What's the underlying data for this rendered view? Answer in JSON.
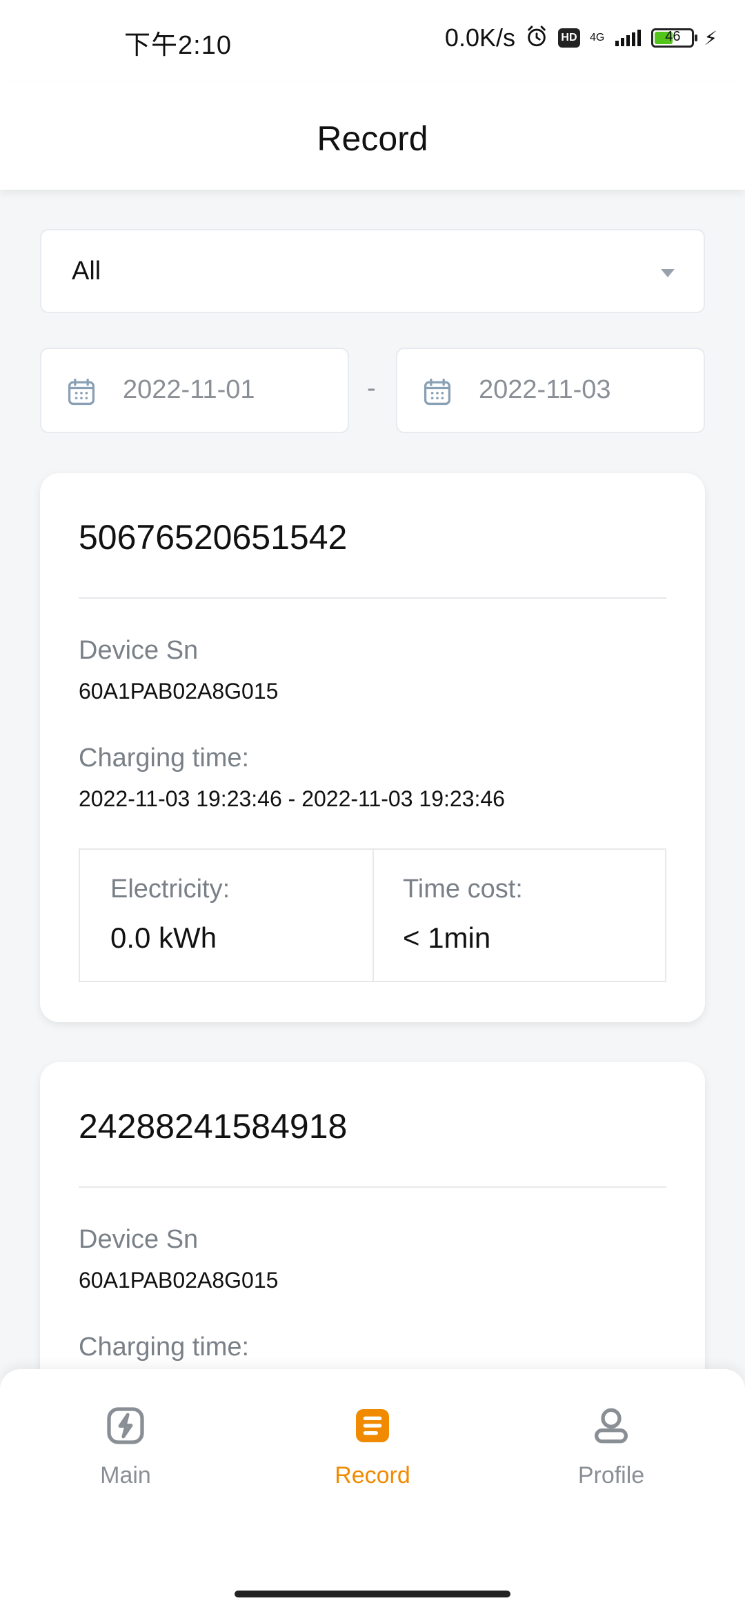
{
  "status_bar": {
    "time": "下午2:10",
    "network_speed": "0.0K/s",
    "hd_label": "HD",
    "network_type": "4G",
    "battery_level": "46"
  },
  "header": {
    "title": "Record"
  },
  "filter": {
    "selected": "All"
  },
  "date_range": {
    "start": "2022-11-01",
    "separator": "-",
    "end": "2022-11-03"
  },
  "records": [
    {
      "id": "50676520651542",
      "device_sn_label": "Device Sn",
      "device_sn": "60A1PAB02A8G015",
      "charging_time_label": "Charging time:",
      "charging_time": "2022-11-03 19:23:46 - 2022-11-03 19:23:46",
      "electricity_label": "Electricity:",
      "electricity": "0.0 kWh",
      "time_cost_label": "Time cost:",
      "time_cost": "< 1min"
    },
    {
      "id": "24288241584918",
      "device_sn_label": "Device Sn",
      "device_sn": "60A1PAB02A8G015",
      "charging_time_label": "Charging time:"
    }
  ],
  "bottom_nav": {
    "main": "Main",
    "record": "Record",
    "profile": "Profile",
    "active_color": "#f08a00",
    "inactive_color": "#8a8f96"
  }
}
